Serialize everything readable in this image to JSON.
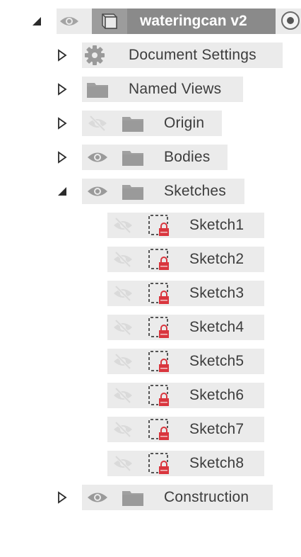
{
  "browser": {
    "root": {
      "title": "wateringcan v2",
      "expanded": true,
      "visible": true,
      "active": true,
      "icon": "component-cube-icon"
    },
    "items": [
      {
        "label": "Document Settings",
        "expanded": false,
        "icon": "gear-icon",
        "visibility": "none"
      },
      {
        "label": "Named Views",
        "expanded": false,
        "icon": "folder-icon",
        "visibility": "none"
      },
      {
        "label": "Origin",
        "expanded": false,
        "icon": "folder-icon",
        "visibility": "hidden"
      },
      {
        "label": "Bodies",
        "expanded": false,
        "icon": "folder-icon",
        "visibility": "visible"
      },
      {
        "label": "Sketches",
        "expanded": true,
        "icon": "folder-icon",
        "visibility": "visible",
        "children": [
          {
            "label": "Sketch1",
            "icon": "locked-sketch-icon",
            "visibility": "hidden"
          },
          {
            "label": "Sketch2",
            "icon": "locked-sketch-icon",
            "visibility": "hidden"
          },
          {
            "label": "Sketch3",
            "icon": "locked-sketch-icon",
            "visibility": "hidden"
          },
          {
            "label": "Sketch4",
            "icon": "locked-sketch-icon",
            "visibility": "hidden"
          },
          {
            "label": "Sketch5",
            "icon": "locked-sketch-icon",
            "visibility": "hidden"
          },
          {
            "label": "Sketch6",
            "icon": "locked-sketch-icon",
            "visibility": "hidden"
          },
          {
            "label": "Sketch7",
            "icon": "locked-sketch-icon",
            "visibility": "hidden"
          },
          {
            "label": "Sketch8",
            "icon": "locked-sketch-icon",
            "visibility": "hidden"
          }
        ]
      },
      {
        "label": "Construction",
        "expanded": false,
        "icon": "folder-icon",
        "visibility": "visible"
      }
    ]
  },
  "colors": {
    "row_background": "#ebebeb",
    "root_title_background": "#8a8a8a",
    "icon_gray": "#9a9a9a",
    "lock_red": "#d9363e"
  }
}
